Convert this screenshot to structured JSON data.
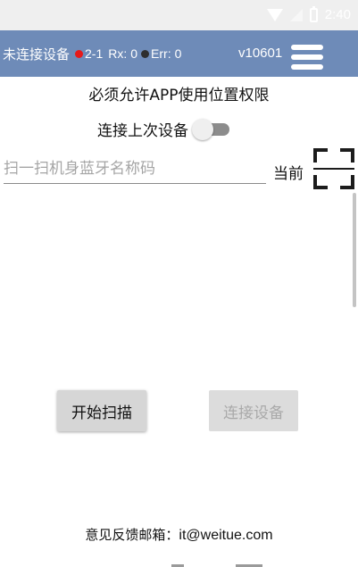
{
  "status_bar": {
    "time": "2:40",
    "icons": [
      "wifi-icon",
      "signal-icon",
      "battery-icon"
    ]
  },
  "app_bar": {
    "connection_status": "未连接设备",
    "channel": "2-1",
    "rx_label": "Rx:",
    "rx_value": "0",
    "err_label": "Err:",
    "err_value": "0",
    "version": "v10601",
    "menu_icon": "hamburger-menu-icon",
    "colors": {
      "background": "#6e8bb8",
      "status_dot_rx": "#e61919",
      "status_dot_err": "#2e2e2e"
    }
  },
  "main": {
    "permission_notice": "必须允许APP使用位置权限",
    "reconnect_label": "连接上次设备",
    "reconnect_enabled": false,
    "scan_input": {
      "placeholder": "扫一扫机身蓝牙名称码",
      "value": ""
    },
    "current_label": "当前",
    "scan_icon": "qr-scan-icon"
  },
  "buttons": {
    "start_scan": "开始扫描",
    "connect_device": "连接设备"
  },
  "footer": {
    "feedback_label": "意见反馈邮箱：",
    "feedback_email": "it@weitue.com"
  }
}
